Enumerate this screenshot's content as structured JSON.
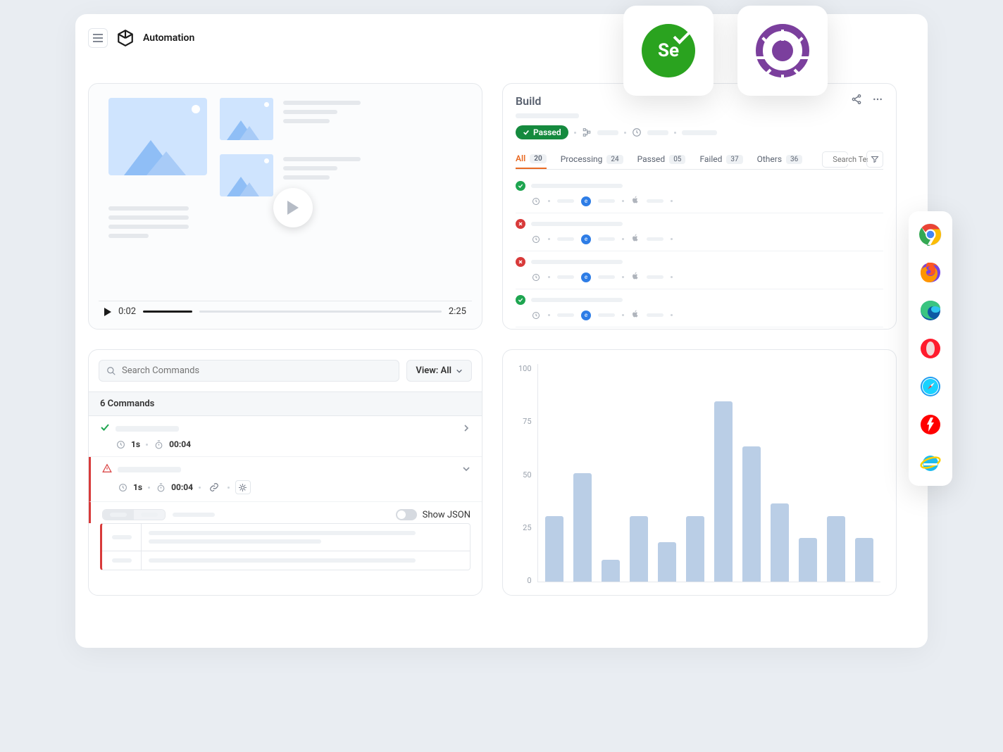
{
  "header": {
    "title": "Automation"
  },
  "video": {
    "current": "0:02",
    "duration": "2:25"
  },
  "build": {
    "title": "Build",
    "status_label": "Passed",
    "tabs": [
      {
        "label": "All",
        "count": "20"
      },
      {
        "label": "Processing",
        "count": "24"
      },
      {
        "label": "Passed",
        "count": "05"
      },
      {
        "label": "Failed",
        "count": "37"
      },
      {
        "label": "Others",
        "count": "36"
      }
    ],
    "search_placeholder": "Search Tests",
    "tests": [
      {
        "status": "pass"
      },
      {
        "status": "fail"
      },
      {
        "status": "fail"
      },
      {
        "status": "pass"
      }
    ]
  },
  "commands": {
    "search_placeholder": "Search Commands",
    "view_label": "View: All",
    "count_label": "6 Commands",
    "item1": {
      "duration": "1s",
      "timestamp": "00:04"
    },
    "item2": {
      "duration": "1s",
      "timestamp": "00:04"
    },
    "json_label": "Show JSON"
  },
  "chart_data": {
    "type": "bar",
    "title": "",
    "xlabel": "",
    "ylabel": "",
    "ylim": [
      0,
      100
    ],
    "y_ticks": [
      "100",
      "75",
      "50",
      "25",
      "0"
    ],
    "values": [
      30,
      50,
      10,
      30,
      18,
      30,
      83,
      62,
      36,
      20,
      30,
      20
    ]
  },
  "integrations": {
    "selenium_label": "Se",
    "browsers": [
      "chrome",
      "firefox",
      "edge",
      "opera",
      "safari",
      "yandex",
      "ie"
    ]
  }
}
